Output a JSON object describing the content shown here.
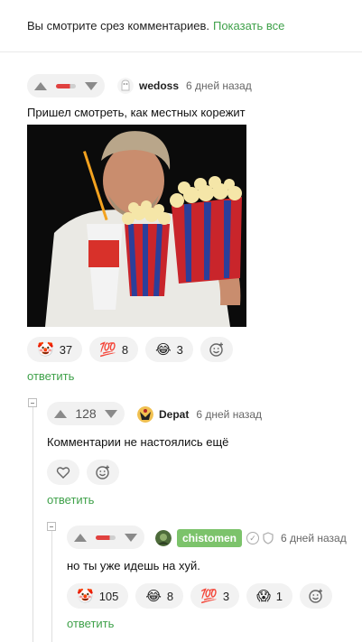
{
  "banner": {
    "text": "Вы смотрите срез комментариев.",
    "link": "Показать все"
  },
  "comment1": {
    "author": "wedoss",
    "date": "6 дней назад",
    "text": "Пришел смотреть, как местных корежит",
    "reactions": [
      {
        "emoji": "🤡",
        "count": "37"
      },
      {
        "emoji": "💯",
        "count": "8"
      },
      {
        "emoji": "😂",
        "count": "3"
      }
    ],
    "reply": "ответить"
  },
  "comment2": {
    "score": "128",
    "author": "Depat",
    "date": "6 дней назад",
    "text": "Комментарии не настоялись ещё",
    "reply": "ответить"
  },
  "comment3": {
    "author": "chistomen",
    "date": "6 дней назад",
    "text": "но ты уже идешь на хуй.",
    "reactions": [
      {
        "emoji": "🤡",
        "count": "105"
      },
      {
        "emoji": "😂",
        "count": "8"
      },
      {
        "emoji": "💯",
        "count": "3"
      },
      {
        "emoji": "😱",
        "count": "1"
      }
    ],
    "reply": "ответить"
  },
  "icons": {
    "upvote": "triangle-up",
    "downvote": "triangle-down",
    "add_reaction": "smiley-plus",
    "like": "heart-outline",
    "verified": "check-circle",
    "shield": "shield-outline"
  }
}
